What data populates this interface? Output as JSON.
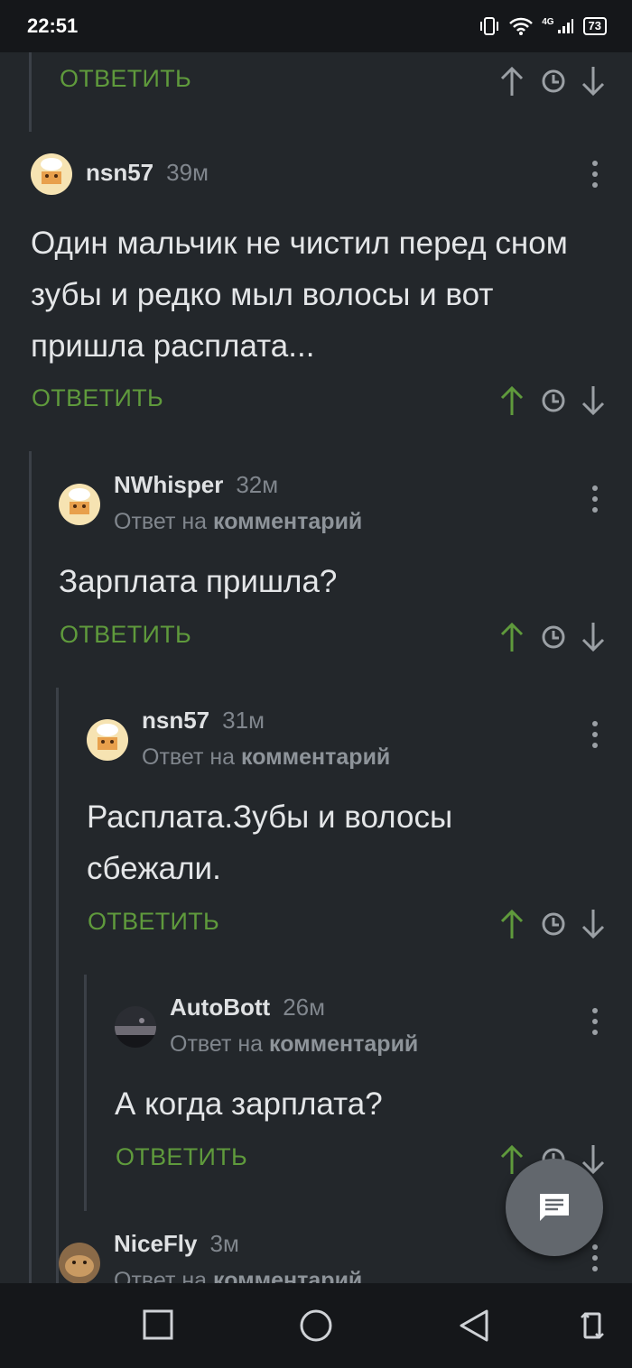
{
  "status_bar": {
    "time": "22:51",
    "network": "4G",
    "battery": "73"
  },
  "reply_label": "ОТВЕТИТЬ",
  "comments": [
    {
      "author": "nsn57",
      "time": "39м",
      "text": "Один мальчик не чистил перед сном зубы и редко мыл волосы и вот пришла расплата..."
    },
    {
      "author": "NWhisper",
      "time": "32м",
      "reply_prefix": "Ответ на",
      "reply_target": "комментарий",
      "text": "Зарплата пришла?"
    },
    {
      "author": "nsn57",
      "time": "31м",
      "reply_prefix": "Ответ на",
      "reply_target": "комментарий",
      "text": "Расплата.Зубы и волосы сбежали."
    },
    {
      "author": "AutoBott",
      "time": "26м",
      "reply_prefix": "Ответ на",
      "reply_target": "комментарий",
      "text": "А когда зарплата?"
    },
    {
      "author": "NiceFly",
      "time": "3м",
      "reply_prefix": "Ответ на",
      "reply_target": "комментарий"
    }
  ],
  "partial_top_reply_label": "ОТВЕТИТЬ",
  "colors": {
    "background": "#23272b",
    "accent_green": "#5f9a3c",
    "bars": "#15171a"
  },
  "icons": [
    "vibrate-icon",
    "wifi-icon",
    "signal-icon",
    "battery-icon",
    "more-icon",
    "upvote-icon",
    "clock-icon",
    "downvote-icon",
    "comment-fab-icon",
    "recent-apps-icon",
    "home-icon",
    "back-icon",
    "rotate-icon"
  ]
}
